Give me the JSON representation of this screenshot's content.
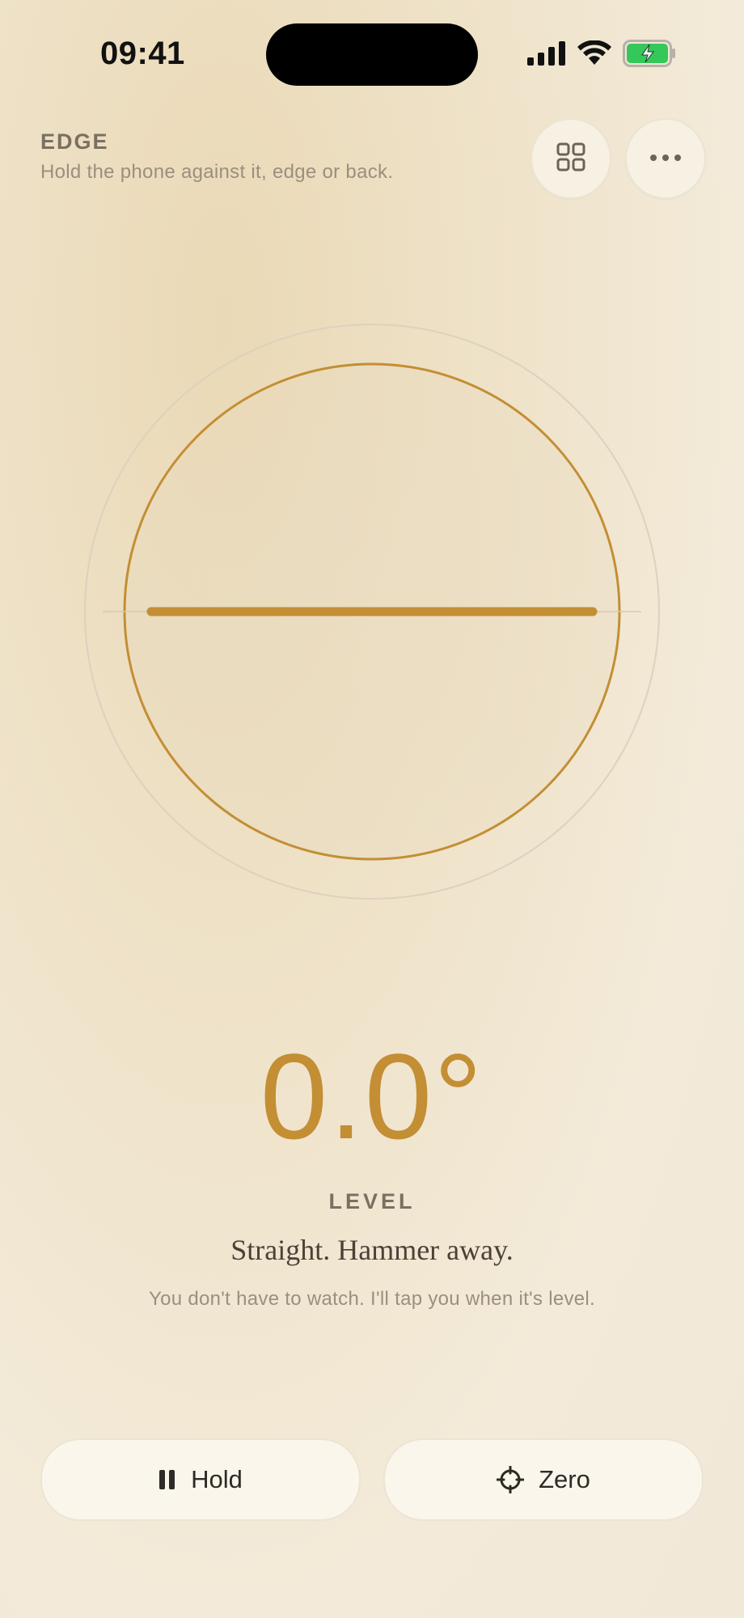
{
  "status_bar": {
    "time": "09:41",
    "icons": [
      "signal-icon",
      "wifi-icon",
      "battery-charging-icon"
    ],
    "battery_color": "#34c759"
  },
  "header": {
    "mode": "EDGE",
    "hint": "Hold the phone against it, edge or back.",
    "grid_button_icon": "grid-icon",
    "more_button_icon": "more-icon"
  },
  "readout": {
    "angle": "0.0°",
    "state": "LEVEL",
    "message": "Straight. Hammer away.",
    "submessage": "You don't have to watch. I'll tap you when it's level.",
    "tilt_degrees": 0
  },
  "actions": {
    "hold_label": "Hold",
    "hold_icon": "pause-icon",
    "zero_label": "Zero",
    "zero_icon": "crosshair-icon"
  },
  "colors": {
    "accent": "#c38e34",
    "background": "#efe3ca"
  }
}
